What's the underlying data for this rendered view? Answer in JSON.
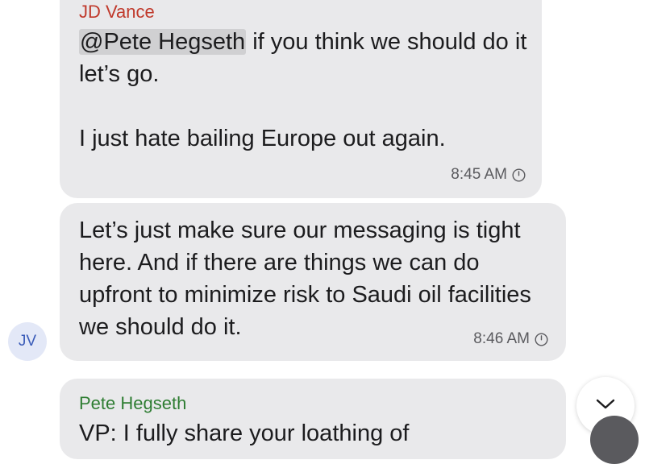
{
  "messages": [
    {
      "sender": "JD Vance",
      "mention": "@Pete Hegseth",
      "text_after_mention": " if you think we should do it let’s go.",
      "text_paragraph2": "I just hate bailing Europe out again.",
      "time": "8:45 AM"
    },
    {
      "text": "Let’s just make sure our messaging is tight here. And if there are things we can do upfront to minimize risk to Saudi oil facilities we should do it.",
      "time": "8:46 AM"
    },
    {
      "sender": "Pete Hegseth",
      "text": "VP: I fully share your loathing of"
    }
  ],
  "avatar": {
    "initials": "JV"
  },
  "icons": {
    "status": "clock-icon",
    "scroll_down": "chevron-down-icon"
  },
  "colors": {
    "bubble_bg": "#e9e9eb",
    "sender_jd": "#c0392b",
    "sender_pete": "#2e7d32",
    "avatar_bg": "#e3e8f7",
    "avatar_text": "#3a5bb8"
  }
}
